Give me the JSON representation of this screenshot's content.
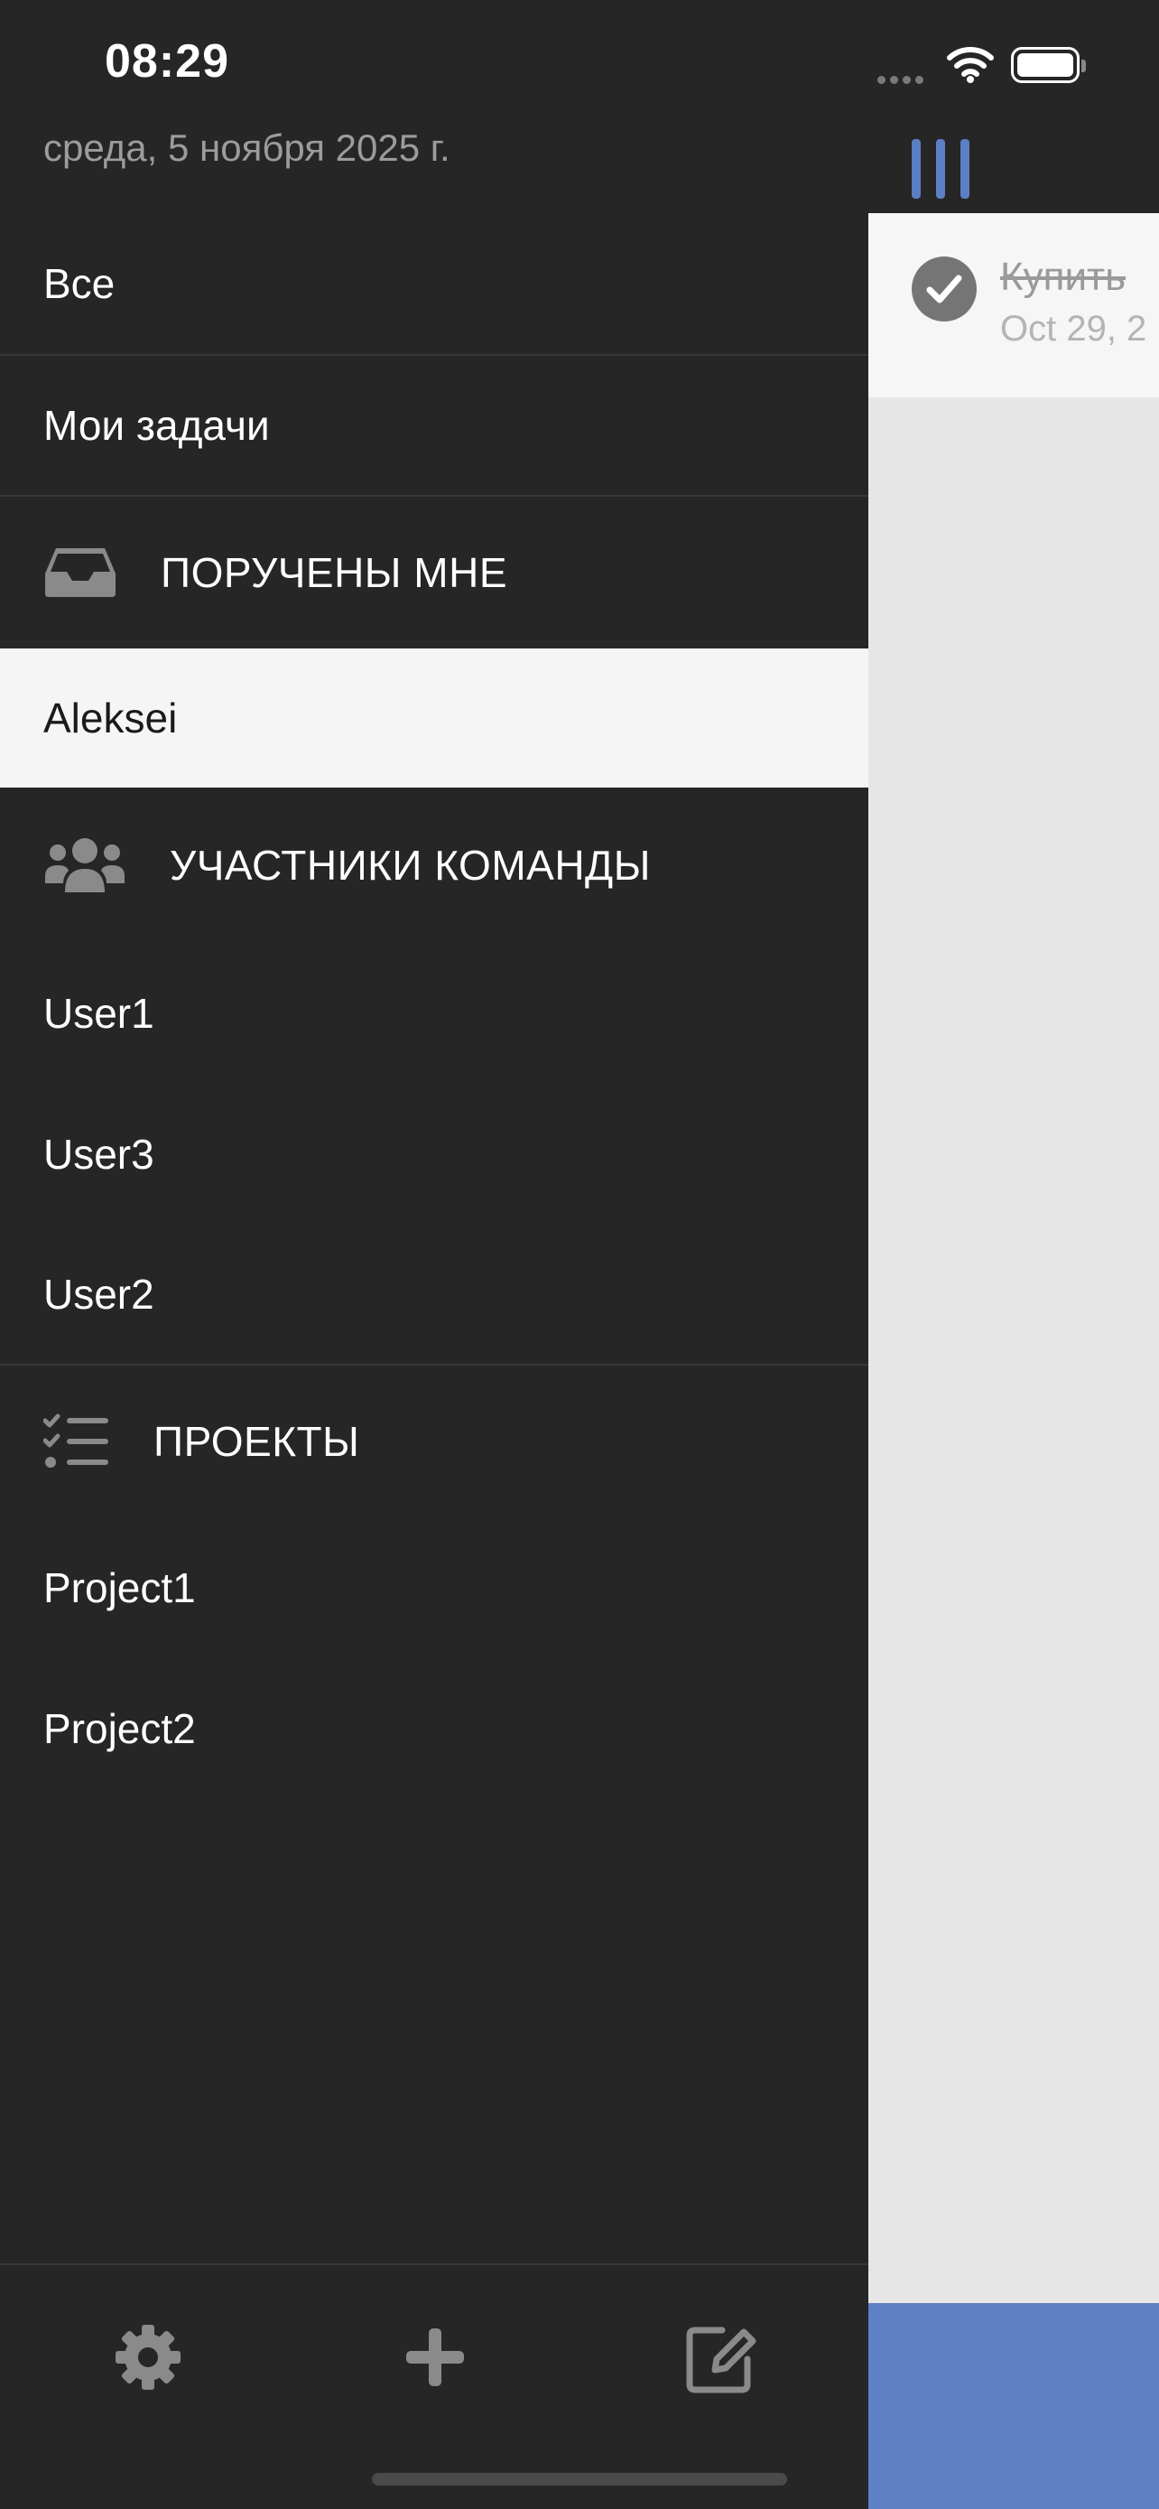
{
  "status_bar": {
    "time": "08:29"
  },
  "drawer": {
    "date": "среда, 5 ноября 2025 г.",
    "items": {
      "all": "Все",
      "my_tasks": "Мои задачи"
    },
    "assigned_section": {
      "title": "ПОРУЧЕНЫ МНЕ",
      "icon": "inbox-icon",
      "items": [
        "Aleksei"
      ]
    },
    "team_section": {
      "title": "УЧАСТНИКИ КОМАНДЫ",
      "icon": "users-icon",
      "items": [
        "User1",
        "User3",
        "User2"
      ]
    },
    "projects_section": {
      "title": "ПРОЕКТЫ",
      "icon": "checklist-icon",
      "items": [
        "Project1",
        "Project2"
      ]
    },
    "toolbar": {
      "icons": [
        "gear-icon",
        "plus-icon",
        "edit-icon"
      ]
    }
  },
  "main": {
    "task": {
      "title": "Купить",
      "date": "Oct 29, 2",
      "completed": true
    }
  },
  "colors": {
    "drawer_bg": "#262626",
    "selected_row_bg": "#f5f5f5",
    "accent": "#5f80c4",
    "content_bg": "#e6e6e6"
  }
}
